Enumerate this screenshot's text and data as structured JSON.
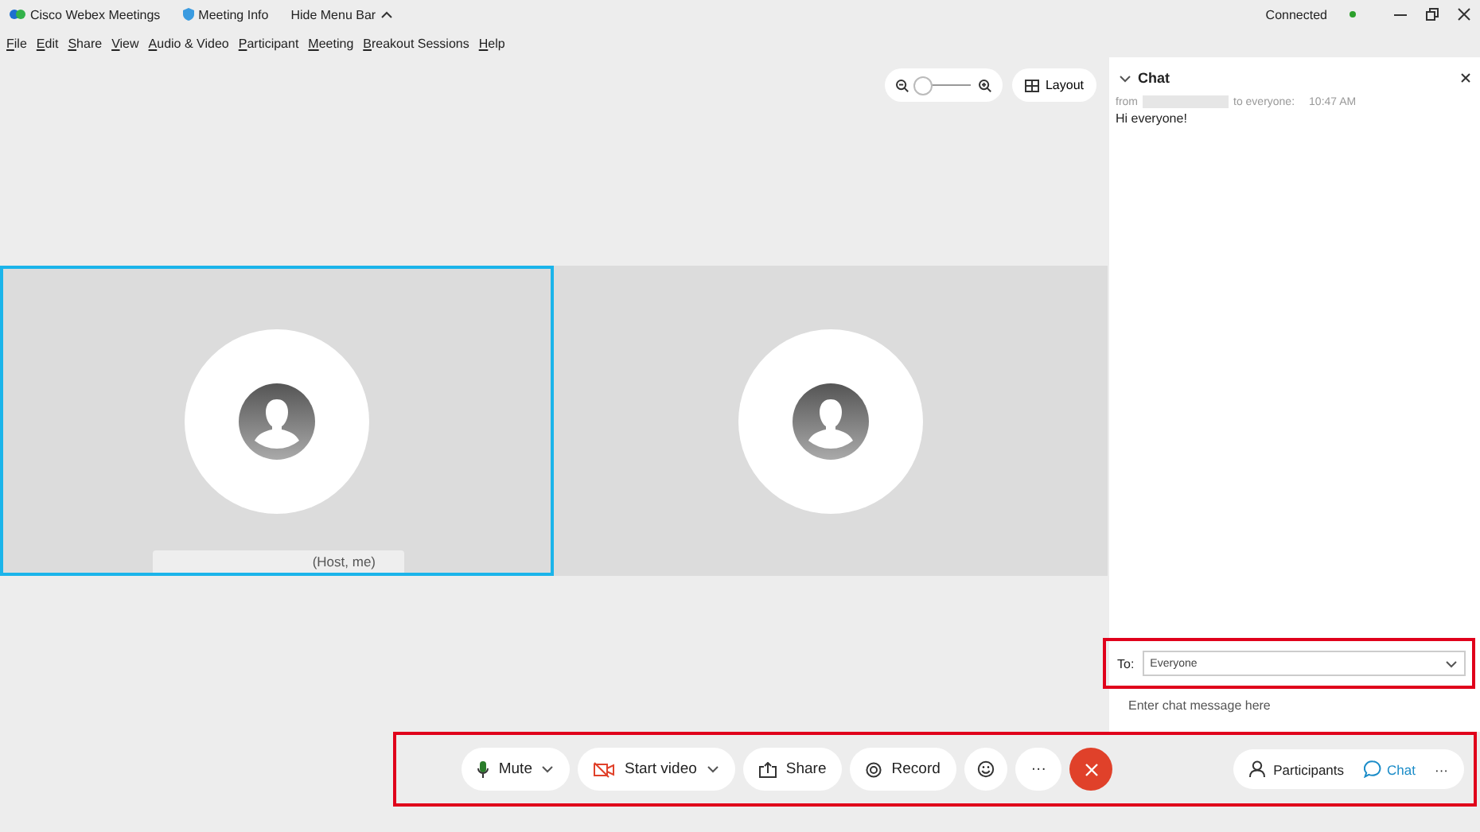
{
  "title_bar": {
    "app_name": "Cisco Webex Meetings",
    "meeting_info": "Meeting Info",
    "hide_menu_bar": "Hide Menu Bar",
    "status": "Connected"
  },
  "menu": [
    "File",
    "Edit",
    "Share",
    "View",
    "Audio & Video",
    "Participant",
    "Meeting",
    "Breakout Sessions",
    "Help"
  ],
  "zoom": {
    "level": 0.1
  },
  "layout_button": "Layout",
  "video_tiles": [
    {
      "selected": true,
      "name_label": "(Host, me)"
    },
    {
      "selected": false
    }
  ],
  "chat": {
    "title": "Chat",
    "messages": [
      {
        "from": "from",
        "to": "to everyone:",
        "time": "10:47 AM",
        "text": "Hi everyone!"
      }
    ],
    "to_label": "To:",
    "recipient": "Everyone",
    "placeholder": "Enter chat message here"
  },
  "toolbar": {
    "controls": [
      {
        "kind": "mic",
        "label": "Mute",
        "dropdown": true
      },
      {
        "kind": "video",
        "label": "Start video",
        "dropdown": true
      },
      {
        "kind": "share",
        "label": "Share",
        "dropdown": false
      },
      {
        "kind": "record",
        "label": "Record",
        "dropdown": false
      },
      {
        "kind": "reactions",
        "dropdown": false
      },
      {
        "kind": "more",
        "label": "···",
        "dropdown": false
      }
    ],
    "panels": [
      {
        "kind": "participants",
        "label": "Participants",
        "selected": false
      },
      {
        "kind": "chat",
        "label": "Chat",
        "selected": true
      }
    ],
    "panel_more": "···"
  }
}
